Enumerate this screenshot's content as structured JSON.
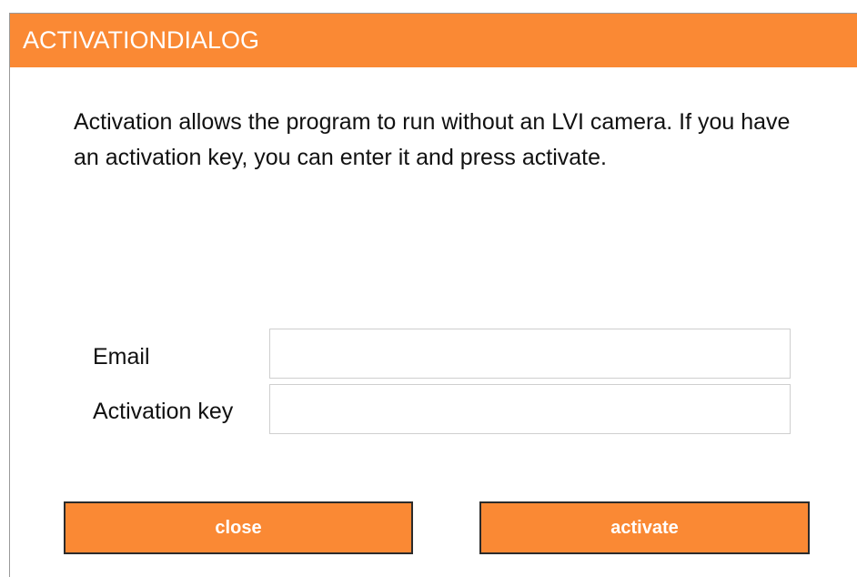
{
  "dialog": {
    "title": "ACTIVATIONDIALOG",
    "description": "Activation allows the program to run without an LVI camera. If you have an activation key, you can enter it and press activate.",
    "email": {
      "label": "Email",
      "value": "",
      "placeholder": ""
    },
    "activation_key": {
      "label": "Activation key",
      "value": "",
      "placeholder": ""
    },
    "buttons": {
      "close_label": "close",
      "activate_label": "activate"
    }
  },
  "colors": {
    "accent": "#fa8934",
    "button_text": "#ffffff",
    "title_text": "#ffffff"
  }
}
